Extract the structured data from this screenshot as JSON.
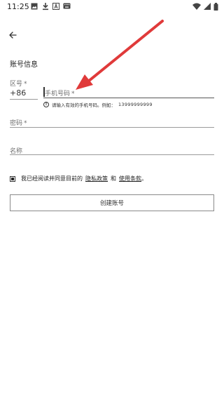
{
  "status_bar": {
    "time": "11:25",
    "icons_left": [
      "image-icon",
      "download-icon",
      "text-a-icon",
      "keyboard-icon"
    ],
    "icons_right": [
      "wifi-icon",
      "signal-icon",
      "battery-icon"
    ]
  },
  "header": {
    "back_icon": "arrow-left-icon"
  },
  "section_title": "账号信息",
  "fields": {
    "region": {
      "label": "区号",
      "required": "*",
      "value": "+86"
    },
    "phone": {
      "label": "手机号码",
      "required": "*",
      "helper_text": "请输入有效的手机号码。例如：",
      "helper_example": "13999999999"
    },
    "password": {
      "label": "密码",
      "required": "*"
    },
    "name": {
      "label": "名称"
    }
  },
  "agreement": {
    "prefix": "我已经阅读并同意目前的",
    "privacy_link": "隐私政策",
    "and": "和",
    "terms_link": "使用条款",
    "suffix": "。"
  },
  "create_button": "创建账号",
  "colors": {
    "annotation": "#e03a3a",
    "text": "#222222",
    "border": "#8a8a8a"
  }
}
